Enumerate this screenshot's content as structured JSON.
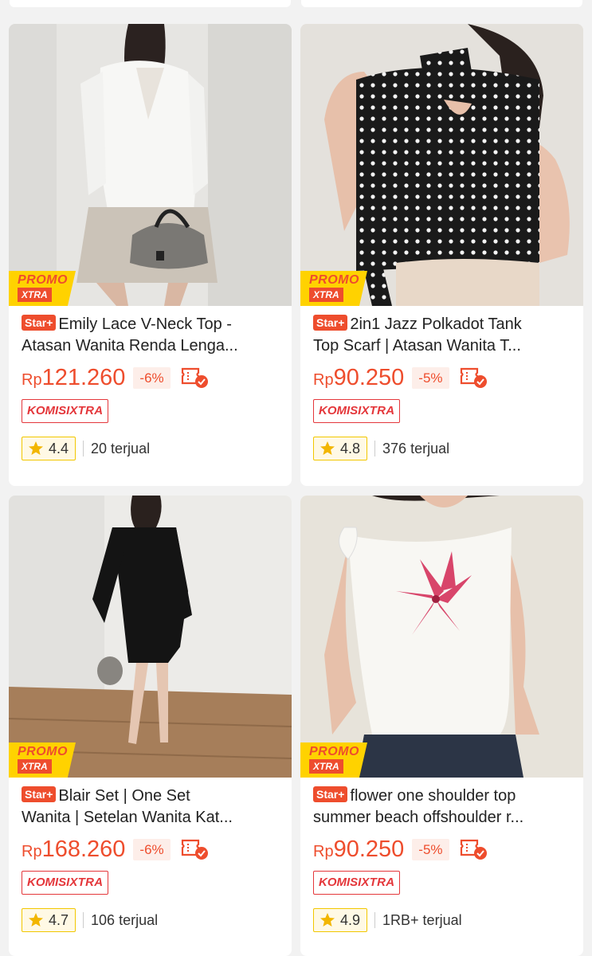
{
  "products": [
    {
      "badge": "Star+",
      "title_line1": "Emily Lace V-Neck Top -",
      "title_line2": "Atasan Wanita Renda Lenga...",
      "currency": "Rp",
      "price": "121.260",
      "discount": "-6%",
      "promo_line1": "PROMO",
      "promo_line2": "XTRA",
      "komisi_a": "KOMISI",
      "komisi_b": "XTRA",
      "rating": "4.4",
      "sold": "20 terjual"
    },
    {
      "badge": "Star+",
      "title_line1": "2in1 Jazz Polkadot Tank",
      "title_line2": "Top Scarf | Atasan Wanita T...",
      "currency": "Rp",
      "price": "90.250",
      "discount": "-5%",
      "promo_line1": "PROMO",
      "promo_line2": "XTRA",
      "komisi_a": "KOMISI",
      "komisi_b": "XTRA",
      "rating": "4.8",
      "sold": "376 terjual"
    },
    {
      "badge": "Star+",
      "title_line1": "Blair Set | One Set",
      "title_line2": "Wanita | Setelan Wanita Kat...",
      "currency": "Rp",
      "price": "168.260",
      "discount": "-6%",
      "promo_line1": "PROMO",
      "promo_line2": "XTRA",
      "komisi_a": "KOMISI",
      "komisi_b": "XTRA",
      "rating": "4.7",
      "sold": "106 terjual"
    },
    {
      "badge": "Star+",
      "title_line1": "flower one shoulder top",
      "title_line2": "summer beach offshoulder r...",
      "currency": "Rp",
      "price": "90.250",
      "discount": "-5%",
      "promo_line1": "PROMO",
      "promo_line2": "XTRA",
      "komisi_a": "KOMISI",
      "komisi_b": "XTRA",
      "rating": "4.9",
      "sold": "1RB+ terjual"
    }
  ],
  "colors": {
    "accent": "#ee4d2d",
    "promo_yellow": "#ffd200",
    "rating_border": "#f2c700",
    "page_bg": "#f2f2f2"
  },
  "icons": [
    "voucher-check-icon",
    "star-icon"
  ]
}
